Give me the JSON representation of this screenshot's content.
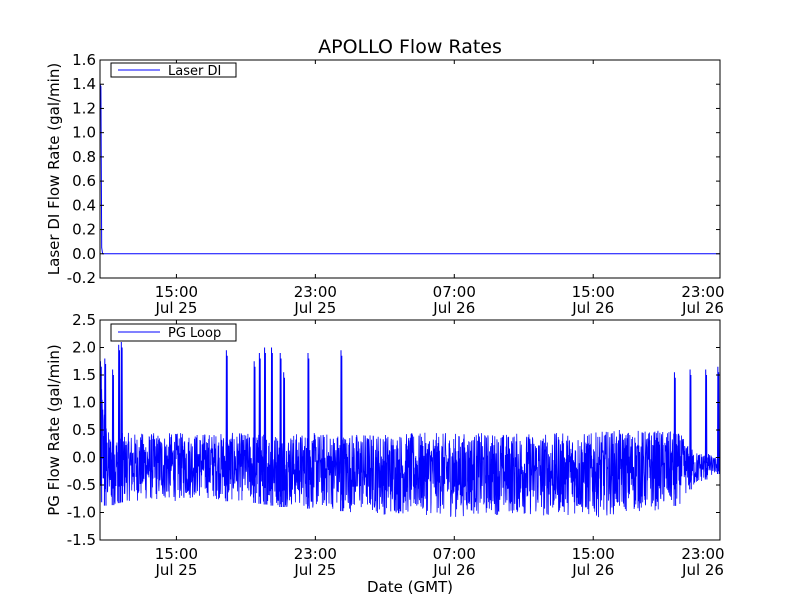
{
  "title": "APOLLO Flow Rates",
  "xlabel": "Date (GMT)",
  "chart_data": [
    {
      "type": "line",
      "ylabel": "Laser DI Flow Rate (gal/min)",
      "ylim": [
        -0.2,
        1.6
      ],
      "yticks": [
        "-0.2",
        "0.0",
        "0.2",
        "0.4",
        "0.6",
        "0.8",
        "1.0",
        "1.2",
        "1.4",
        "1.6"
      ],
      "xlim": [
        10.6,
        46.3
      ],
      "xticks": [
        {
          "hour": 15,
          "time": "15:00",
          "date": "Jul 25"
        },
        {
          "hour": 23,
          "time": "23:00",
          "date": "Jul 25"
        },
        {
          "hour": 31,
          "time": "07:00",
          "date": "Jul 26"
        },
        {
          "hour": 39,
          "time": "15:00",
          "date": "Jul 26"
        },
        {
          "hour": 47,
          "time": "23:00",
          "date": "Jul 26"
        }
      ],
      "x_units": "hours since 2024-07-25 00:00 GMT",
      "legend": "upper left",
      "grid": false,
      "series": [
        {
          "name": "Laser DI",
          "color": "#0000ff",
          "points": [
            [
              10.6,
              1.4
            ],
            [
              10.65,
              1.38
            ],
            [
              10.7,
              0.05
            ],
            [
              10.75,
              0.0
            ],
            [
              11.0,
              0.0
            ],
            [
              20.0,
              0.0
            ],
            [
              30.0,
              0.0
            ],
            [
              40.0,
              0.0
            ],
            [
              46.3,
              0.0
            ]
          ]
        }
      ]
    },
    {
      "type": "line",
      "ylabel": "PG Flow Rate (gal/min)",
      "ylim": [
        -1.5,
        2.5
      ],
      "yticks": [
        "-1.5",
        "-1.0",
        "-0.5",
        "0.0",
        "0.5",
        "1.0",
        "1.5",
        "2.0",
        "2.5"
      ],
      "xlim": [
        10.6,
        46.3
      ],
      "xticks": [
        {
          "hour": 15,
          "time": "15:00",
          "date": "Jul 25"
        },
        {
          "hour": 23,
          "time": "23:00",
          "date": "Jul 25"
        },
        {
          "hour": 31,
          "time": "07:00",
          "date": "Jul 26"
        },
        {
          "hour": 39,
          "time": "15:00",
          "date": "Jul 26"
        },
        {
          "hour": 47,
          "time": "23:00",
          "date": "Jul 26"
        }
      ],
      "legend": "upper left",
      "grid": false,
      "series": [
        {
          "name": "PG Loop",
          "color": "#0000ff",
          "noise_envelope": {
            "x": [
              10.6,
              11.0,
              11.5,
              12.0,
              13.0,
              14.0,
              15.0,
              16.0,
              17.0,
              18.0,
              19.0,
              20.0,
              21.0,
              22.0,
              23.0,
              24.0,
              25.0,
              26.0,
              27.0,
              28.0,
              29.0,
              30.0,
              31.0,
              32.0,
              33.0,
              34.0,
              35.0,
              36.0,
              37.0,
              38.0,
              39.0,
              40.0,
              41.0,
              42.0,
              43.0,
              44.0,
              44.5,
              45.0,
              45.5,
              46.0,
              46.3
            ],
            "upper": [
              1.8,
              0.5,
              0.45,
              0.45,
              0.45,
              0.45,
              0.45,
              0.45,
              0.45,
              0.45,
              0.45,
              0.45,
              0.45,
              0.45,
              0.45,
              0.45,
              0.45,
              0.45,
              0.45,
              0.45,
              0.45,
              0.45,
              0.45,
              0.45,
              0.45,
              0.45,
              0.45,
              0.45,
              0.45,
              0.45,
              0.45,
              0.5,
              0.5,
              0.5,
              0.5,
              0.45,
              0.2,
              0.1,
              0.1,
              0.0,
              0.0
            ],
            "lower": [
              -0.8,
              -0.9,
              -0.85,
              -0.8,
              -0.8,
              -0.8,
              -0.8,
              -0.75,
              -0.75,
              -0.8,
              -0.8,
              -0.85,
              -0.9,
              -0.9,
              -0.95,
              -0.95,
              -1.0,
              -1.0,
              -1.05,
              -1.05,
              -1.05,
              -1.05,
              -1.1,
              -1.05,
              -1.05,
              -1.05,
              -1.05,
              -1.1,
              -1.05,
              -1.05,
              -1.1,
              -1.05,
              -1.0,
              -1.0,
              -0.95,
              -0.85,
              -0.6,
              -0.5,
              -0.4,
              -0.3,
              -0.3
            ]
          },
          "spikes": [
            {
              "x": 10.65,
              "peak": 1.75
            },
            {
              "x": 10.9,
              "peak": 1.8
            },
            {
              "x": 11.35,
              "peak": 1.6
            },
            {
              "x": 11.7,
              "peak": 2.05
            },
            {
              "x": 11.85,
              "peak": 2.1
            },
            {
              "x": 17.9,
              "peak": 1.95
            },
            {
              "x": 19.5,
              "peak": 1.75
            },
            {
              "x": 19.8,
              "peak": 1.9
            },
            {
              "x": 20.1,
              "peak": 2.0
            },
            {
              "x": 20.5,
              "peak": 2.0
            },
            {
              "x": 21.0,
              "peak": 1.9
            },
            {
              "x": 21.2,
              "peak": 1.55
            },
            {
              "x": 22.6,
              "peak": 1.9
            },
            {
              "x": 24.5,
              "peak": 1.95
            },
            {
              "x": 43.7,
              "peak": 1.55
            },
            {
              "x": 44.6,
              "peak": 1.6
            },
            {
              "x": 45.5,
              "peak": 1.6
            },
            {
              "x": 46.2,
              "peak": 1.65
            }
          ]
        }
      ]
    }
  ]
}
